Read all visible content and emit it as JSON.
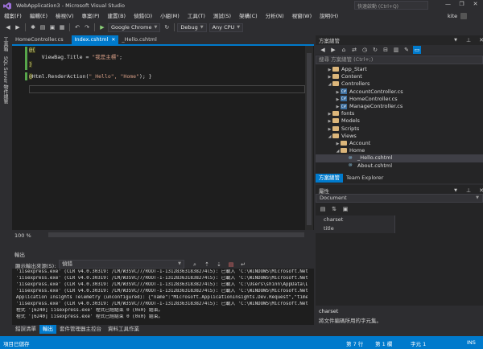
{
  "window": {
    "title": "WebApplication3 - Microsoft Visual Studio",
    "quick_launch_placeholder": "快速啟動 (Ctrl+Q)",
    "controls": [
      "—",
      "❐",
      "✕"
    ]
  },
  "menu": {
    "items": [
      "檔案(F)",
      "編輯(E)",
      "檢視(V)",
      "專案(P)",
      "建置(B)",
      "偵錯(D)",
      "小組(M)",
      "工具(T)",
      "測試(S)",
      "架構(C)",
      "分析(N)",
      "視窗(W)",
      "說明(H)"
    ],
    "user": "kite"
  },
  "toolbar": {
    "browser": "Google Chrome",
    "config": "Debug",
    "platform": "Any CPU"
  },
  "left_strip": {
    "tabs": [
      "工具箱",
      "SQL Server 物件總管"
    ]
  },
  "doc_tabs": [
    {
      "label": "HomeController.cs",
      "active": false
    },
    {
      "label": "Index.cshtml",
      "active": true
    },
    {
      "label": "_Hello.cshtml",
      "active": false
    }
  ],
  "editor": {
    "lines": [
      {
        "at": "@{",
        "rest": ""
      },
      {
        "at": "",
        "rest": "    ViewBag.Title = ",
        "str": "\"我是主標\"",
        "tail": ";"
      },
      {
        "at": "}",
        "rest": ""
      },
      {
        "at": "@",
        "rest": "Html.RenderAction(",
        "str": "\"_Hello\", \"Home\"",
        "tail": "); }"
      }
    ],
    "zoom": "100 %"
  },
  "output": {
    "title": "輸出",
    "source_label": "顯示輸出來源(S):",
    "source_value": "偵錯",
    "lines": [
      "'iisexpress.exe' (CLR v4.0.30319: /LM/W3SVC/7/ROOT-1-131283631838274l5): 已載入 'C:\\WINDOWS\\Microsoft.Net\\assemb",
      "'iisexpress.exe' (CLR v4.0.30319: /LM/W3SVC/7/ROOT-1-131283631838274l5): 已載入 'C:\\WINDOWS\\Microsoft.Net\\assemb",
      "'iisexpress.exe' (CLR v4.0.30319: /LM/W3SVC/7/ROOT-1-131283631838274l5): 已載入 'C:\\Users\\shinn\\AppData\\Local\\Te",
      "'iisexpress.exe' (CLR v4.0.30319: /LM/W3SVC/7/ROOT-1-131283631838274l5): 已載入 'C:\\WINDOWS\\Microsoft.Net\\assemb",
      "Application Insights Telemetry (unconfigured): {\"name\":\"Microsoft.ApplicationInsights.Dev.Request\",\"time\":\"2017-01",
      "'iisexpress.exe' (CLR v4.0.30319: /LM/W3SVC/7/ROOT-1-131283631838274l5): 已載入 'C:\\WINDOWS\\Microsoft.Net\\assemb",
      "程式 '[6240] iisexpress.exe' 程式已經結束 0 (0x0) 結束。",
      "程式 '[6240] iisexpress.exe' 程式已經結束 0 (0x0) 結束。"
    ]
  },
  "bottom_tabs": [
    {
      "label": "錯誤清單",
      "active": false
    },
    {
      "label": "輸出",
      "active": true
    },
    {
      "label": "套件管理器主控台",
      "active": false
    },
    {
      "label": "資料工具作業",
      "active": false
    }
  ],
  "solution_explorer": {
    "title": "方案總管",
    "search_placeholder": "搜尋 方案總管 (Ctrl+;)",
    "items": [
      {
        "label": "App_Start",
        "type": "folder",
        "indent": 1,
        "twisty": "▶"
      },
      {
        "label": "Content",
        "type": "folder",
        "indent": 1,
        "twisty": "▶"
      },
      {
        "label": "Controllers",
        "type": "folder",
        "indent": 1,
        "twisty": "◢"
      },
      {
        "label": "AccountController.cs",
        "type": "cs",
        "indent": 2,
        "twisty": "▶"
      },
      {
        "label": "HomeController.cs",
        "type": "cs",
        "indent": 2,
        "twisty": "▶"
      },
      {
        "label": "ManageController.cs",
        "type": "cs",
        "indent": 2,
        "twisty": "▶"
      },
      {
        "label": "fonts",
        "type": "folder",
        "indent": 1,
        "twisty": "▶"
      },
      {
        "label": "Models",
        "type": "folder",
        "indent": 1,
        "twisty": "▶"
      },
      {
        "label": "Scripts",
        "type": "folder",
        "indent": 1,
        "twisty": "▶"
      },
      {
        "label": "Views",
        "type": "folder",
        "indent": 1,
        "twisty": "◢"
      },
      {
        "label": "Account",
        "type": "folder",
        "indent": 2,
        "twisty": "▶"
      },
      {
        "label": "Home",
        "type": "folder",
        "indent": 2,
        "twisty": "◢"
      },
      {
        "label": "_Hello.cshtml",
        "type": "cshtml",
        "indent": 3,
        "twisty": "",
        "selected": true
      },
      {
        "label": "About.cshtml",
        "type": "cshtml",
        "indent": 3,
        "twisty": ""
      }
    ],
    "tabs": [
      {
        "label": "方案總管",
        "active": true
      },
      {
        "label": "Team Explorer",
        "active": false
      }
    ]
  },
  "properties": {
    "title": "屬性",
    "object": "Document",
    "rows": [
      {
        "name": "charset",
        "value": ""
      },
      {
        "name": "title",
        "value": ""
      }
    ],
    "desc_title": "charset",
    "desc_text": "將文件編碼所用的字元集。"
  },
  "status": {
    "left": "項目已儲存",
    "line": "第 7 行",
    "col": "第 1 欄",
    "ch": "字元 1",
    "mode": "INS"
  },
  "colors": {
    "accent": "#007acc",
    "background": "#2d2d30",
    "editor": "#1e1e1e"
  }
}
